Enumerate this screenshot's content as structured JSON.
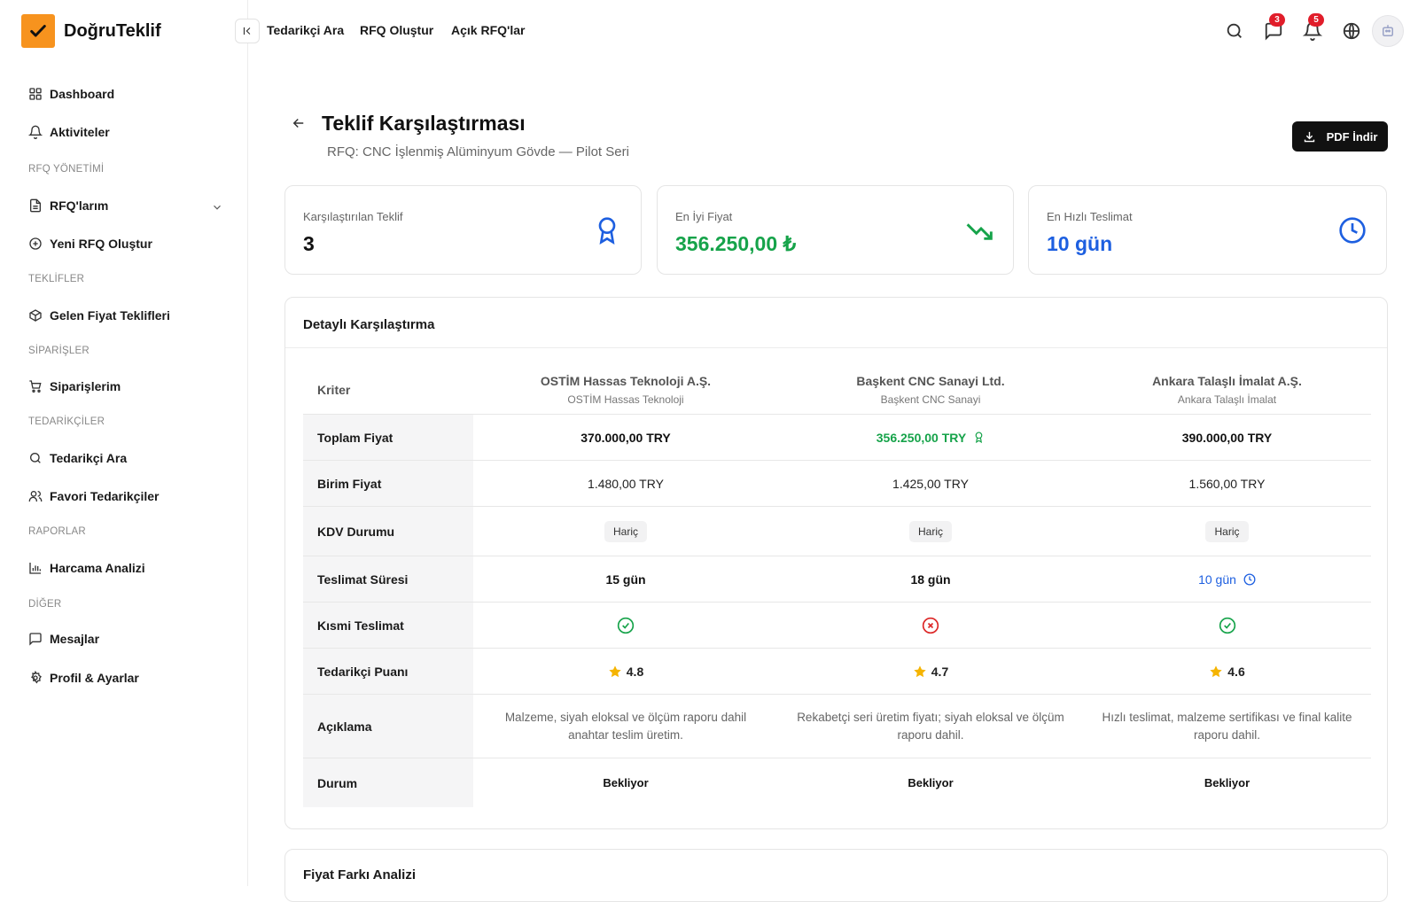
{
  "brand": {
    "name": "DoğruTeklif",
    "color": "#f7931e"
  },
  "sidebar": {
    "items": [
      {
        "label": "Dashboard",
        "icon": "grid-icon"
      },
      {
        "label": "Aktiviteler",
        "icon": "bell-icon"
      },
      {
        "label": "RFQ'larım",
        "icon": "file-icon"
      },
      {
        "label": "Yeni RFQ Oluştur",
        "icon": "plus-circle-icon"
      },
      {
        "label": "Gelen Fiyat Teklifleri",
        "icon": "box-icon"
      },
      {
        "label": "Siparişlerim",
        "icon": "cart-icon"
      },
      {
        "label": "Tedarikçi Ara",
        "icon": "search-icon"
      },
      {
        "label": "Favori Tedarikçiler",
        "icon": "users-icon"
      },
      {
        "label": "Harcama Analizi",
        "icon": "bar-chart-icon"
      },
      {
        "label": "Mesajlar",
        "icon": "message-icon"
      },
      {
        "label": "Profil & Ayarlar",
        "icon": "gear-icon"
      }
    ],
    "sections": [
      "RFQ YÖNETİMİ",
      "TEKLİFLER",
      "SİPARİŞLER",
      "TEDARİKÇİLER",
      "RAPORLAR",
      "DİĞER"
    ]
  },
  "topbar": {
    "links": [
      "Tedarikçi Ara",
      "RFQ Oluştur",
      "Açık RFQ'lar"
    ],
    "messages_badge": "3",
    "notifications_badge": "5"
  },
  "page": {
    "title": "Teklif Karşılaştırması",
    "subtitle": "RFQ: CNC İşlenmiş Alüminyum Gövde — Pilot Seri",
    "pdf_button": "PDF İndir"
  },
  "stats": [
    {
      "label": "Karşılaştırılan Teklif",
      "value": "3",
      "color": "#111111"
    },
    {
      "label": "En İyi Fiyat",
      "value": "356.250,00 ₺",
      "color": "#16a34a"
    },
    {
      "label": "En Hızlı Teslimat",
      "value": "10 gün",
      "color": "#1d5fe0"
    }
  ],
  "comparison": {
    "title": "Detaylı Karşılaştırma",
    "criteria_header": "Kriter",
    "suppliers": [
      {
        "name": "OSTİM Hassas Teknoloji A.Ş.",
        "short": "OSTİM Hassas Teknoloji"
      },
      {
        "name": "Başkent CNC Sanayi Ltd.",
        "short": "Başkent CNC Sanayi"
      },
      {
        "name": "Ankara Talaşlı İmalat A.Ş.",
        "short": "Ankara Talaşlı İmalat"
      }
    ],
    "rows": {
      "total_price": {
        "label": "Toplam Fiyat",
        "values": [
          "370.000,00 TRY",
          "356.250,00 TRY",
          "390.000,00 TRY"
        ]
      },
      "unit_price": {
        "label": "Birim Fiyat",
        "values": [
          "1.480,00 TRY",
          "1.425,00 TRY",
          "1.560,00 TRY"
        ]
      },
      "vat": {
        "label": "KDV Durumu",
        "values": [
          "Hariç",
          "Hariç",
          "Hariç"
        ]
      },
      "delivery": {
        "label": "Teslimat Süresi",
        "values": [
          "15 gün",
          "18 gün",
          "10 gün"
        ]
      },
      "partial": {
        "label": "Kısmi Teslimat",
        "values": [
          true,
          false,
          true
        ]
      },
      "rating": {
        "label": "Tedarikçi Puanı",
        "values": [
          "4.8",
          "4.7",
          "4.6"
        ]
      },
      "description": {
        "label": "Açıklama",
        "values": [
          "Malzeme, siyah eloksal ve ölçüm raporu dahil anahtar teslim üretim.",
          "Rekabetçi seri üretim fiyatı; siyah eloksal ve ölçüm raporu dahil.",
          "Hızlı teslimat, malzeme sertifikası ve final kalite raporu dahil."
        ]
      },
      "status": {
        "label": "Durum",
        "values": [
          "Bekliyor",
          "Bekliyor",
          "Bekliyor"
        ]
      }
    }
  },
  "price_analysis": {
    "title": "Fiyat Farkı Analizi"
  }
}
